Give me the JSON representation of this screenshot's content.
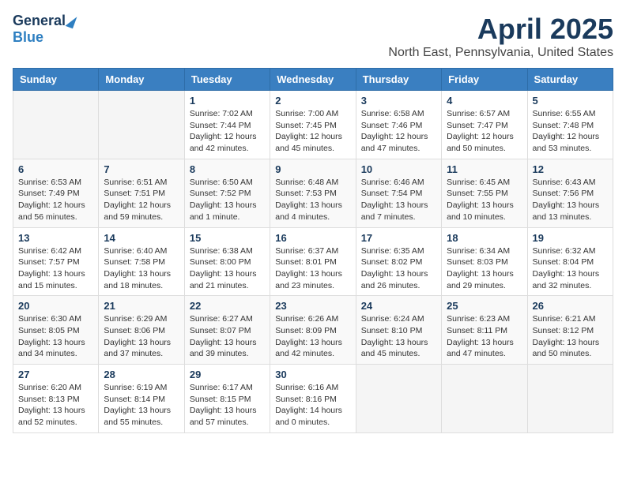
{
  "header": {
    "logo_general": "General",
    "logo_blue": "Blue",
    "month": "April 2025",
    "location": "North East, Pennsylvania, United States"
  },
  "weekdays": [
    "Sunday",
    "Monday",
    "Tuesday",
    "Wednesday",
    "Thursday",
    "Friday",
    "Saturday"
  ],
  "weeks": [
    [
      {
        "day": "",
        "detail": ""
      },
      {
        "day": "",
        "detail": ""
      },
      {
        "day": "1",
        "detail": "Sunrise: 7:02 AM\nSunset: 7:44 PM\nDaylight: 12 hours\nand 42 minutes."
      },
      {
        "day": "2",
        "detail": "Sunrise: 7:00 AM\nSunset: 7:45 PM\nDaylight: 12 hours\nand 45 minutes."
      },
      {
        "day": "3",
        "detail": "Sunrise: 6:58 AM\nSunset: 7:46 PM\nDaylight: 12 hours\nand 47 minutes."
      },
      {
        "day": "4",
        "detail": "Sunrise: 6:57 AM\nSunset: 7:47 PM\nDaylight: 12 hours\nand 50 minutes."
      },
      {
        "day": "5",
        "detail": "Sunrise: 6:55 AM\nSunset: 7:48 PM\nDaylight: 12 hours\nand 53 minutes."
      }
    ],
    [
      {
        "day": "6",
        "detail": "Sunrise: 6:53 AM\nSunset: 7:49 PM\nDaylight: 12 hours\nand 56 minutes."
      },
      {
        "day": "7",
        "detail": "Sunrise: 6:51 AM\nSunset: 7:51 PM\nDaylight: 12 hours\nand 59 minutes."
      },
      {
        "day": "8",
        "detail": "Sunrise: 6:50 AM\nSunset: 7:52 PM\nDaylight: 13 hours\nand 1 minute."
      },
      {
        "day": "9",
        "detail": "Sunrise: 6:48 AM\nSunset: 7:53 PM\nDaylight: 13 hours\nand 4 minutes."
      },
      {
        "day": "10",
        "detail": "Sunrise: 6:46 AM\nSunset: 7:54 PM\nDaylight: 13 hours\nand 7 minutes."
      },
      {
        "day": "11",
        "detail": "Sunrise: 6:45 AM\nSunset: 7:55 PM\nDaylight: 13 hours\nand 10 minutes."
      },
      {
        "day": "12",
        "detail": "Sunrise: 6:43 AM\nSunset: 7:56 PM\nDaylight: 13 hours\nand 13 minutes."
      }
    ],
    [
      {
        "day": "13",
        "detail": "Sunrise: 6:42 AM\nSunset: 7:57 PM\nDaylight: 13 hours\nand 15 minutes."
      },
      {
        "day": "14",
        "detail": "Sunrise: 6:40 AM\nSunset: 7:58 PM\nDaylight: 13 hours\nand 18 minutes."
      },
      {
        "day": "15",
        "detail": "Sunrise: 6:38 AM\nSunset: 8:00 PM\nDaylight: 13 hours\nand 21 minutes."
      },
      {
        "day": "16",
        "detail": "Sunrise: 6:37 AM\nSunset: 8:01 PM\nDaylight: 13 hours\nand 23 minutes."
      },
      {
        "day": "17",
        "detail": "Sunrise: 6:35 AM\nSunset: 8:02 PM\nDaylight: 13 hours\nand 26 minutes."
      },
      {
        "day": "18",
        "detail": "Sunrise: 6:34 AM\nSunset: 8:03 PM\nDaylight: 13 hours\nand 29 minutes."
      },
      {
        "day": "19",
        "detail": "Sunrise: 6:32 AM\nSunset: 8:04 PM\nDaylight: 13 hours\nand 32 minutes."
      }
    ],
    [
      {
        "day": "20",
        "detail": "Sunrise: 6:30 AM\nSunset: 8:05 PM\nDaylight: 13 hours\nand 34 minutes."
      },
      {
        "day": "21",
        "detail": "Sunrise: 6:29 AM\nSunset: 8:06 PM\nDaylight: 13 hours\nand 37 minutes."
      },
      {
        "day": "22",
        "detail": "Sunrise: 6:27 AM\nSunset: 8:07 PM\nDaylight: 13 hours\nand 39 minutes."
      },
      {
        "day": "23",
        "detail": "Sunrise: 6:26 AM\nSunset: 8:09 PM\nDaylight: 13 hours\nand 42 minutes."
      },
      {
        "day": "24",
        "detail": "Sunrise: 6:24 AM\nSunset: 8:10 PM\nDaylight: 13 hours\nand 45 minutes."
      },
      {
        "day": "25",
        "detail": "Sunrise: 6:23 AM\nSunset: 8:11 PM\nDaylight: 13 hours\nand 47 minutes."
      },
      {
        "day": "26",
        "detail": "Sunrise: 6:21 AM\nSunset: 8:12 PM\nDaylight: 13 hours\nand 50 minutes."
      }
    ],
    [
      {
        "day": "27",
        "detail": "Sunrise: 6:20 AM\nSunset: 8:13 PM\nDaylight: 13 hours\nand 52 minutes."
      },
      {
        "day": "28",
        "detail": "Sunrise: 6:19 AM\nSunset: 8:14 PM\nDaylight: 13 hours\nand 55 minutes."
      },
      {
        "day": "29",
        "detail": "Sunrise: 6:17 AM\nSunset: 8:15 PM\nDaylight: 13 hours\nand 57 minutes."
      },
      {
        "day": "30",
        "detail": "Sunrise: 6:16 AM\nSunset: 8:16 PM\nDaylight: 14 hours\nand 0 minutes."
      },
      {
        "day": "",
        "detail": ""
      },
      {
        "day": "",
        "detail": ""
      },
      {
        "day": "",
        "detail": ""
      }
    ]
  ]
}
